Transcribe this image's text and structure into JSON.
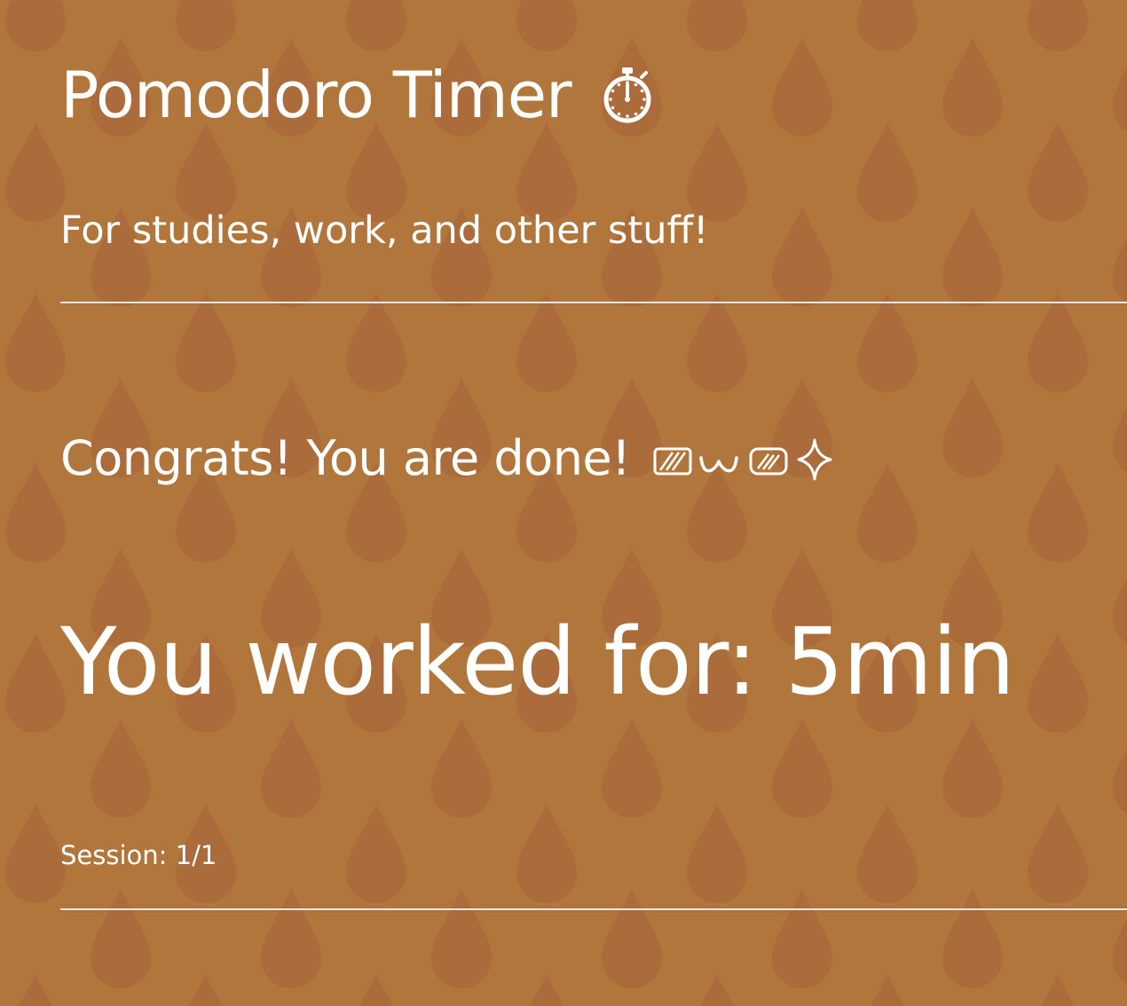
{
  "app": {
    "title": "Pomodoro Timer",
    "title_icon": "stopwatch-icon",
    "subtitle": "For studies, work, and other stuff!"
  },
  "result": {
    "congrats_text": "Congrats! You are done!",
    "kaomoji_icon": "happy-kaomoji-sparkle-icon",
    "worked_text": "You worked for: 5min",
    "session_text": "Session: 1/1"
  },
  "colors": {
    "background": "#b1763c",
    "pattern_drop": "#ab6b3a",
    "text": "#ffffff",
    "divider": "#e9e9e9"
  }
}
